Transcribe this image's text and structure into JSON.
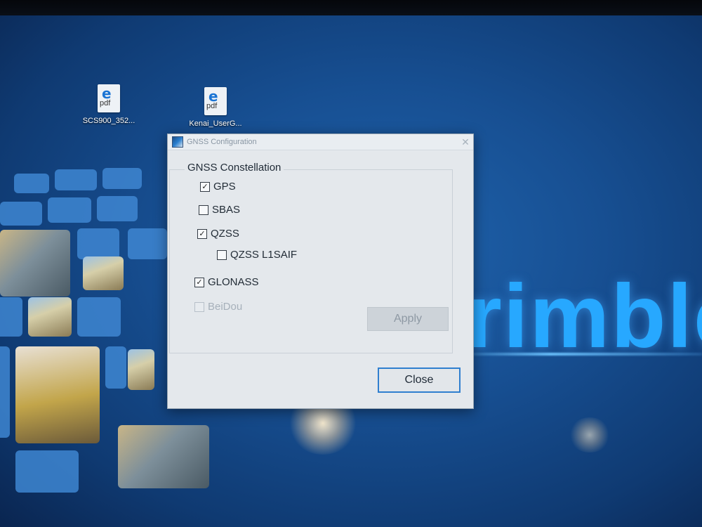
{
  "desktop": {
    "icons": [
      {
        "glyph": "e",
        "type_label": "pdf",
        "label": "SCS900_352..."
      },
      {
        "glyph": "e",
        "type_label": "pdf",
        "label": "Kenai_UserG..."
      }
    ],
    "brand_text": "rimble"
  },
  "dialog": {
    "title": "GNSS Configuration",
    "close_glyph": "✕",
    "group_title": "GNSS Constellation",
    "options": [
      {
        "label": "GPS",
        "checked": true,
        "enabled": true
      },
      {
        "label": "SBAS",
        "checked": false,
        "enabled": true
      },
      {
        "label": "QZSS",
        "checked": true,
        "enabled": true
      },
      {
        "label": "QZSS L1SAIF",
        "checked": false,
        "enabled": true
      },
      {
        "label": "GLONASS",
        "checked": true,
        "enabled": true
      },
      {
        "label": "BeiDou",
        "checked": false,
        "enabled": false
      }
    ],
    "apply_label": "Apply",
    "close_label": "Close"
  },
  "colors": {
    "accent": "#2f7fcf",
    "brand": "#27a8ff"
  }
}
